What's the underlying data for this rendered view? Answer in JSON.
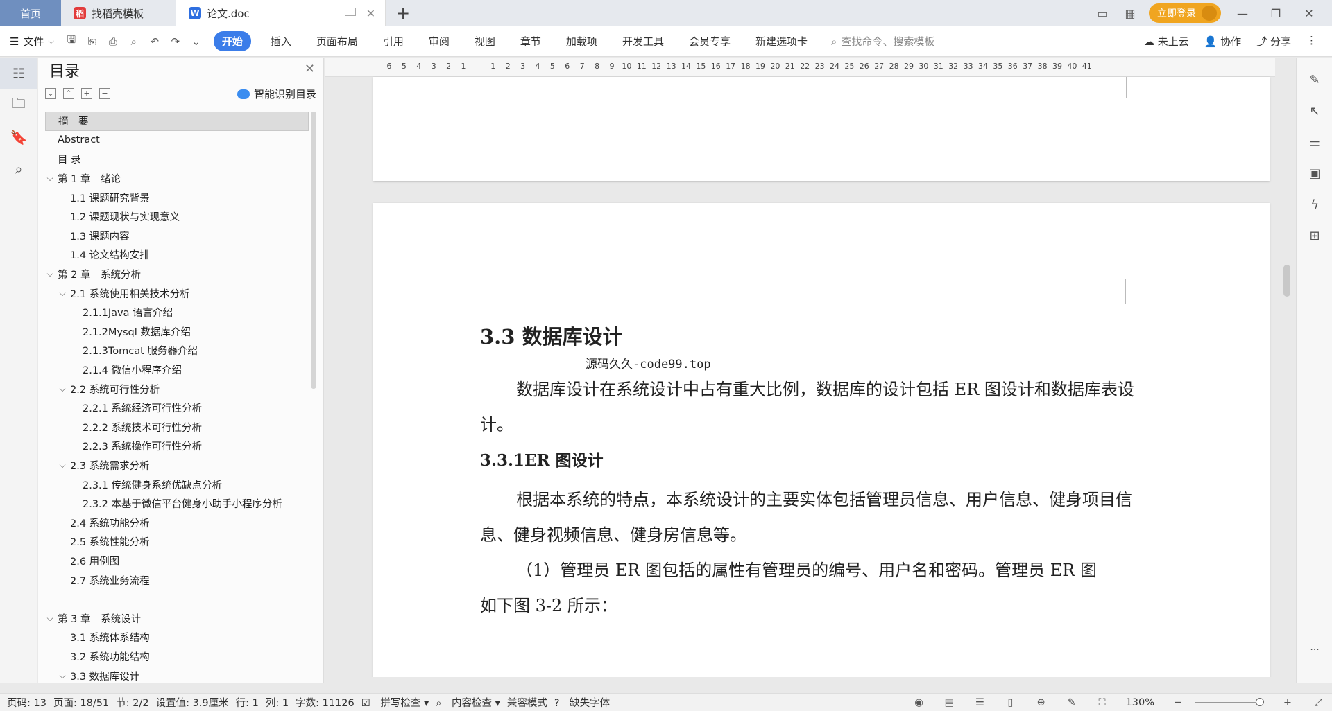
{
  "tabbar": {
    "home": "首页",
    "tab1": "找稻壳模板",
    "tab2": "论文.doc",
    "add": "+",
    "login": "立即登录"
  },
  "ribbon": {
    "file": "文件",
    "tabs": [
      "开始",
      "插入",
      "页面布局",
      "引用",
      "审阅",
      "视图",
      "章节",
      "加载项",
      "开发工具",
      "会员专享",
      "新建选项卡"
    ],
    "search_placeholder": "查找命令、搜索模板",
    "cloud": "未上云",
    "collab": "协作",
    "share": "分享"
  },
  "toc": {
    "title": "目录",
    "smart": "智能识别目录",
    "items": [
      {
        "label": "摘　要",
        "level": 0,
        "chev": ""
      },
      {
        "label": "Abstract",
        "level": 0,
        "chev": ""
      },
      {
        "label": "目 录",
        "level": 0,
        "chev": ""
      },
      {
        "label": "第 1 章　绪论",
        "level": 0,
        "chev": "v"
      },
      {
        "label": "1.1 课题研究背景",
        "level": 1,
        "chev": ""
      },
      {
        "label": "1.2 课题现状与实现意义",
        "level": 1,
        "chev": ""
      },
      {
        "label": "1.3 课题内容",
        "level": 1,
        "chev": ""
      },
      {
        "label": "1.4 论文结构安排",
        "level": 1,
        "chev": ""
      },
      {
        "label": "第 2 章　系统分析",
        "level": 0,
        "chev": "v"
      },
      {
        "label": "2.1 系统使用相关技术分析",
        "level": 1,
        "chev": "v"
      },
      {
        "label": "2.1.1Java 语言介绍",
        "level": 2,
        "chev": ""
      },
      {
        "label": "2.1.2Mysql 数据库介绍",
        "level": 2,
        "chev": ""
      },
      {
        "label": "2.1.3Tomcat 服务器介绍",
        "level": 2,
        "chev": ""
      },
      {
        "label": "2.1.4 微信小程序介绍",
        "level": 2,
        "chev": ""
      },
      {
        "label": "2.2 系统可行性分析",
        "level": 1,
        "chev": "v"
      },
      {
        "label": "2.2.1 系统经济可行性分析",
        "level": 2,
        "chev": ""
      },
      {
        "label": "2.2.2 系统技术可行性分析",
        "level": 2,
        "chev": ""
      },
      {
        "label": "2.2.3 系统操作可行性分析",
        "level": 2,
        "chev": ""
      },
      {
        "label": "2.3 系统需求分析",
        "level": 1,
        "chev": "v"
      },
      {
        "label": "2.3.1 传统健身系统优缺点分析",
        "level": 2,
        "chev": ""
      },
      {
        "label": "2.3.2 本基于微信平台健身小助手小程序分析",
        "level": 2,
        "chev": ""
      },
      {
        "label": "2.4 系统功能分析",
        "level": 1,
        "chev": ""
      },
      {
        "label": "2.5 系统性能分析",
        "level": 1,
        "chev": ""
      },
      {
        "label": "2.6 用例图",
        "level": 1,
        "chev": ""
      },
      {
        "label": "2.7 系统业务流程",
        "level": 1,
        "chev": ""
      },
      {
        "label": "",
        "level": 0,
        "chev": ""
      },
      {
        "label": "第 3 章　系统设计",
        "level": 0,
        "chev": "v"
      },
      {
        "label": "3.1 系统体系结构",
        "level": 1,
        "chev": ""
      },
      {
        "label": "3.2 系统功能结构",
        "level": 1,
        "chev": ""
      },
      {
        "label": "3.3 数据库设计",
        "level": 1,
        "chev": "v"
      }
    ]
  },
  "ruler": [
    "6",
    "5",
    "4",
    "3",
    "2",
    "1",
    "",
    "1",
    "2",
    "3",
    "4",
    "5",
    "6",
    "7",
    "8",
    "9",
    "10",
    "11",
    "12",
    "13",
    "14",
    "15",
    "16",
    "17",
    "18",
    "19",
    "20",
    "21",
    "22",
    "23",
    "24",
    "25",
    "26",
    "27",
    "28",
    "29",
    "30",
    "31",
    "32",
    "33",
    "34",
    "35",
    "36",
    "37",
    "38",
    "39",
    "40",
    "41"
  ],
  "doc": {
    "h1": "3.3 数据库设计",
    "watermark": "源码久久-code99.top",
    "p1": "数据库设计在系统设计中占有重大比例，数据库的设计包括 ER 图设计和数据库表设计。",
    "h2": "3.3.1ER 图设计",
    "p2": "根据本系统的特点，本系统设计的主要实体包括管理员信息、用户信息、健身项目信息、健身视频信息、健身房信息等。",
    "p3a": "（1）管理员 ER 图包括的属性有管理员的编号、用户名和密码。管理员 ER 图",
    "p3b": "如下图 3-2 所示："
  },
  "status": {
    "page": "页码: 13",
    "pages": "页面: 18/51",
    "section": "节: 2/2",
    "setting": "设置值: 3.9厘米",
    "row": "行: 1",
    "col": "列: 1",
    "words": "字数: 11126",
    "spell": "拼写检查",
    "content": "内容检查",
    "compat": "兼容模式",
    "font": "缺失字体",
    "zoom": "130%"
  }
}
